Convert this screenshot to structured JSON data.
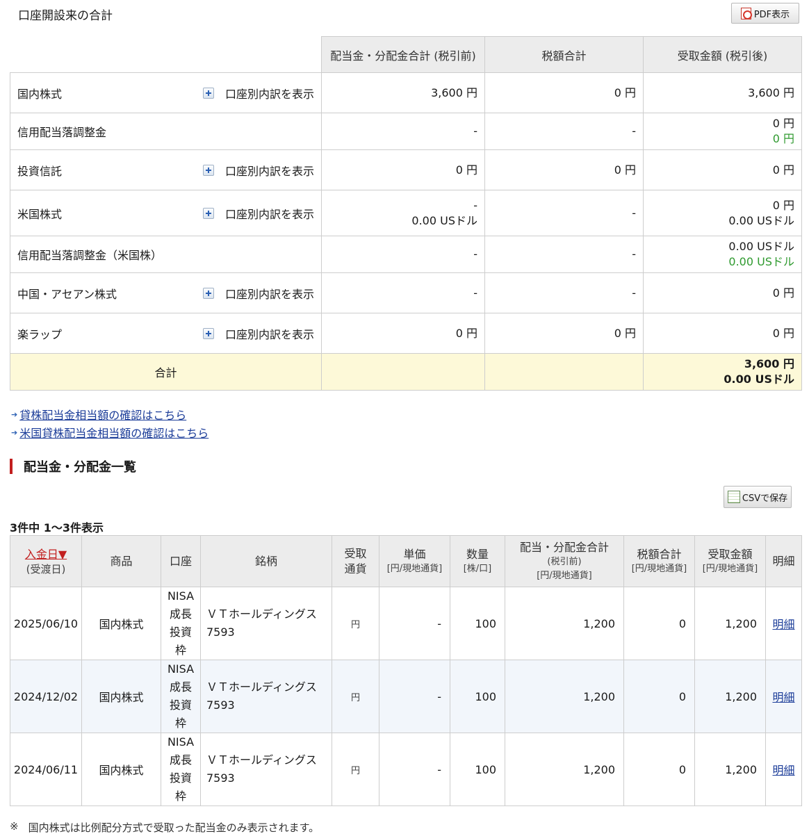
{
  "header": {
    "title": "口座開設来の合計",
    "pdf_label": "PDF表示"
  },
  "summary": {
    "columns": [
      "配当金・分配金合計 (税引前)",
      "税額合計",
      "受取金額 (税引後)"
    ],
    "breakdown_label": "口座別内訳を表示",
    "rows": [
      {
        "label": "国内株式",
        "toggle": true,
        "pre": [
          "3,600 円"
        ],
        "tax": [
          "0 円"
        ],
        "post": [
          "3,600 円"
        ],
        "post_green": []
      },
      {
        "label": "信用配当落調整金",
        "toggle": false,
        "pre": [
          "-"
        ],
        "tax": [
          "-"
        ],
        "post": [
          "0 円"
        ],
        "post_green": [
          "0 円"
        ]
      },
      {
        "label": "投資信託",
        "toggle": true,
        "pre": [
          "0 円"
        ],
        "tax": [
          "0 円"
        ],
        "post": [
          "0 円"
        ],
        "post_green": []
      },
      {
        "label": "米国株式",
        "toggle": true,
        "pre": [
          "-",
          "0.00 USドル"
        ],
        "tax": [
          "-"
        ],
        "post": [
          "0 円",
          "0.00 USドル"
        ],
        "post_green": []
      },
      {
        "label": "信用配当落調整金（米国株）",
        "toggle": false,
        "pre": [
          "-"
        ],
        "tax": [
          "-"
        ],
        "post": [
          "0.00 USドル"
        ],
        "post_green": [
          "0.00 USドル"
        ]
      },
      {
        "label": "中国・アセアン株式",
        "toggle": true,
        "pre": [
          "-"
        ],
        "tax": [
          "-"
        ],
        "post": [
          "0 円"
        ],
        "post_green": []
      },
      {
        "label": "楽ラップ",
        "toggle": true,
        "pre": [
          "0 円"
        ],
        "tax": [
          "0 円"
        ],
        "post": [
          "0 円"
        ],
        "post_green": []
      }
    ],
    "total": {
      "label": "合計",
      "post_yen": "3,600 円",
      "post_usd": "0.00 USドル"
    }
  },
  "links": {
    "lending": "貸株配当金相当額の確認はこちら",
    "us_lending": "米国貸株配当金相当額の確認はこちら"
  },
  "section": {
    "title": "配当金・分配金一覧",
    "csv_label": "CSVで保存",
    "count_text": "3件中 1〜3件表示"
  },
  "list": {
    "headers": {
      "date": "入金日▼",
      "date_sub": "(受渡日)",
      "product": "商品",
      "account": "口座",
      "name": "銘柄",
      "currency_1": "受取",
      "currency_2": "通貨",
      "unit": "単価",
      "unit_sub": "[円/現地通貨]",
      "qty": "数量",
      "qty_sub": "[株/口]",
      "gross": "配当・分配金合計",
      "gross_sub1": "(税引前)",
      "gross_sub2": "[円/現地通貨]",
      "tax": "税額合計",
      "tax_sub": "[円/現地通貨]",
      "net": "受取金額",
      "net_sub": "[円/現地通貨]",
      "detail": "明細"
    },
    "rows": [
      {
        "date": "2025/06/10",
        "product": "国内株式",
        "account": [
          "NISA",
          "成長",
          "投資",
          "枠"
        ],
        "name": "ＶＴホールディングス",
        "code": "7593",
        "currency": "円",
        "unit": "-",
        "qty": "100",
        "gross": "1,200",
        "tax": "0",
        "net": "1,200",
        "detail": "明細"
      },
      {
        "date": "2024/12/02",
        "product": "国内株式",
        "account": [
          "NISA",
          "成長",
          "投資",
          "枠"
        ],
        "name": "ＶＴホールディングス",
        "code": "7593",
        "currency": "円",
        "unit": "-",
        "qty": "100",
        "gross": "1,200",
        "tax": "0",
        "net": "1,200",
        "detail": "明細"
      },
      {
        "date": "2024/06/11",
        "product": "国内株式",
        "account": [
          "NISA",
          "成長",
          "投資",
          "枠"
        ],
        "name": "ＶＴホールディングス",
        "code": "7593",
        "currency": "円",
        "unit": "-",
        "qty": "100",
        "gross": "1,200",
        "tax": "0",
        "net": "1,200",
        "detail": "明細"
      }
    ]
  },
  "footnote": {
    "mark": "※",
    "text": "国内株式は比例配分方式で受取った配当金のみ表示されます。"
  }
}
